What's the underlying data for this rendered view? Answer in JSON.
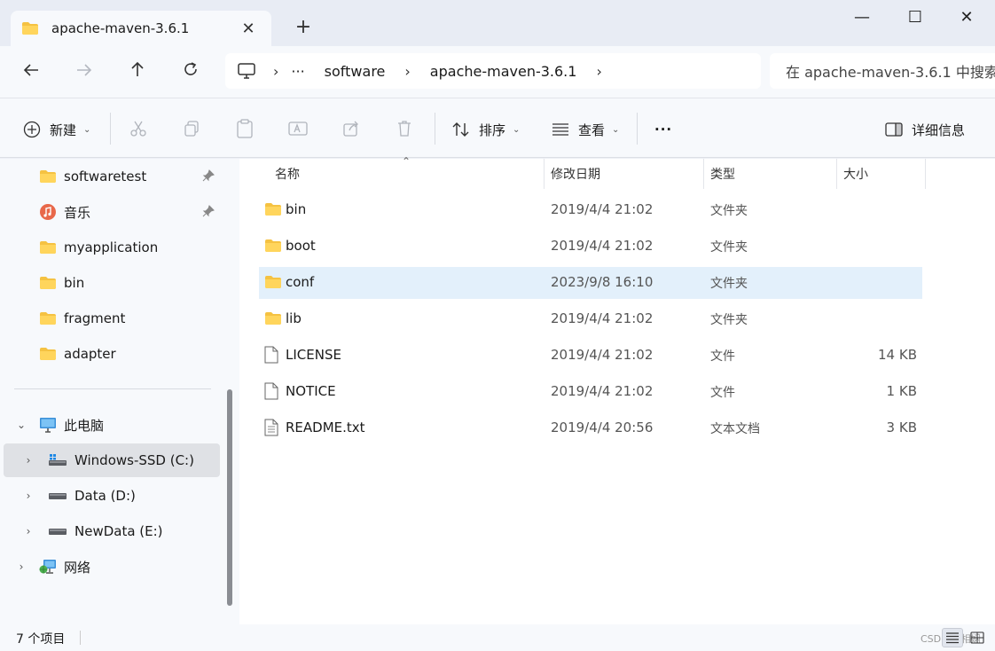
{
  "window": {
    "tab_title": "apache-maven-3.6.1",
    "tab_close": "✕",
    "new_tab": "+",
    "minimize": "—",
    "maximize": "☐",
    "close": "✕"
  },
  "nav": {
    "breadcrumb": [
      "software",
      "apache-maven-3.6.1"
    ],
    "ellipsis": "···",
    "search_placeholder": "在 apache-maven-3.6.1 中搜索"
  },
  "toolbar": {
    "new_label": "新建",
    "sort_label": "排序",
    "view_label": "查看",
    "more_label": "···",
    "details_label": "详细信息"
  },
  "sidebar": {
    "quick_access": [
      {
        "label": "softwaretest",
        "icon": "folder-icon",
        "pinned": true
      },
      {
        "label": "音乐",
        "icon": "music-icon",
        "pinned": true
      },
      {
        "label": "myapplication",
        "icon": "folder-icon",
        "pinned": false
      },
      {
        "label": "bin",
        "icon": "folder-icon",
        "pinned": false
      },
      {
        "label": "fragment",
        "icon": "folder-icon",
        "pinned": false
      },
      {
        "label": "adapter",
        "icon": "folder-icon",
        "pinned": false
      }
    ],
    "this_pc": "此电脑",
    "drives": [
      {
        "label": "Windows-SSD (C:)",
        "selected": true
      },
      {
        "label": "Data (D:)",
        "selected": false
      },
      {
        "label": "NewData (E:)",
        "selected": false
      }
    ],
    "network": "网络"
  },
  "columns": {
    "name": "名称",
    "modified": "修改日期",
    "type": "类型",
    "size": "大小"
  },
  "files": [
    {
      "name": "bin",
      "date": "2019/4/4 21:02",
      "type": "文件夹",
      "size": "",
      "kind": "folder",
      "selected": false
    },
    {
      "name": "boot",
      "date": "2019/4/4 21:02",
      "type": "文件夹",
      "size": "",
      "kind": "folder",
      "selected": false
    },
    {
      "name": "conf",
      "date": "2023/9/8 16:10",
      "type": "文件夹",
      "size": "",
      "kind": "folder",
      "selected": true
    },
    {
      "name": "lib",
      "date": "2019/4/4 21:02",
      "type": "文件夹",
      "size": "",
      "kind": "folder",
      "selected": false
    },
    {
      "name": "LICENSE",
      "date": "2019/4/4 21:02",
      "type": "文件",
      "size": "14 KB",
      "kind": "file",
      "selected": false
    },
    {
      "name": "NOTICE",
      "date": "2019/4/4 21:02",
      "type": "文件",
      "size": "1 KB",
      "kind": "file",
      "selected": false
    },
    {
      "name": "README.txt",
      "date": "2019/4/4 20:56",
      "type": "文本文档",
      "size": "3 KB",
      "kind": "text",
      "selected": false
    }
  ],
  "status": {
    "item_count": "7 个项目",
    "watermark": "CSDN @相娴"
  },
  "colors": {
    "folder": "#f5c242",
    "selection": "#e3f0fb",
    "accent": "#0067c0"
  }
}
